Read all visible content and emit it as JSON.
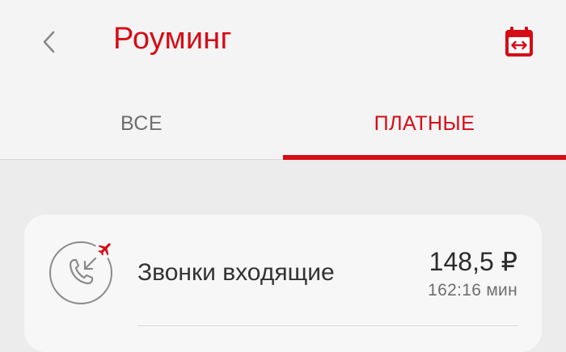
{
  "header": {
    "title": "Роуминг",
    "back_icon": "chevron-left-icon",
    "calendar_icon": "calendar-icon"
  },
  "tabs": [
    {
      "label": "ВСЕ",
      "active": false
    },
    {
      "label": "ПЛАТНЫЕ",
      "active": true
    }
  ],
  "services": [
    {
      "icon": "incoming-call-roaming-icon",
      "name": "Звонки входящие",
      "amount": "148,5 ₽",
      "duration": "162:16 мин"
    }
  ],
  "colors": {
    "accent": "#d50d16",
    "text_primary": "#333333",
    "text_secondary": "#6e6e6e",
    "background": "#ececec",
    "surface": "#f7f7f7"
  }
}
